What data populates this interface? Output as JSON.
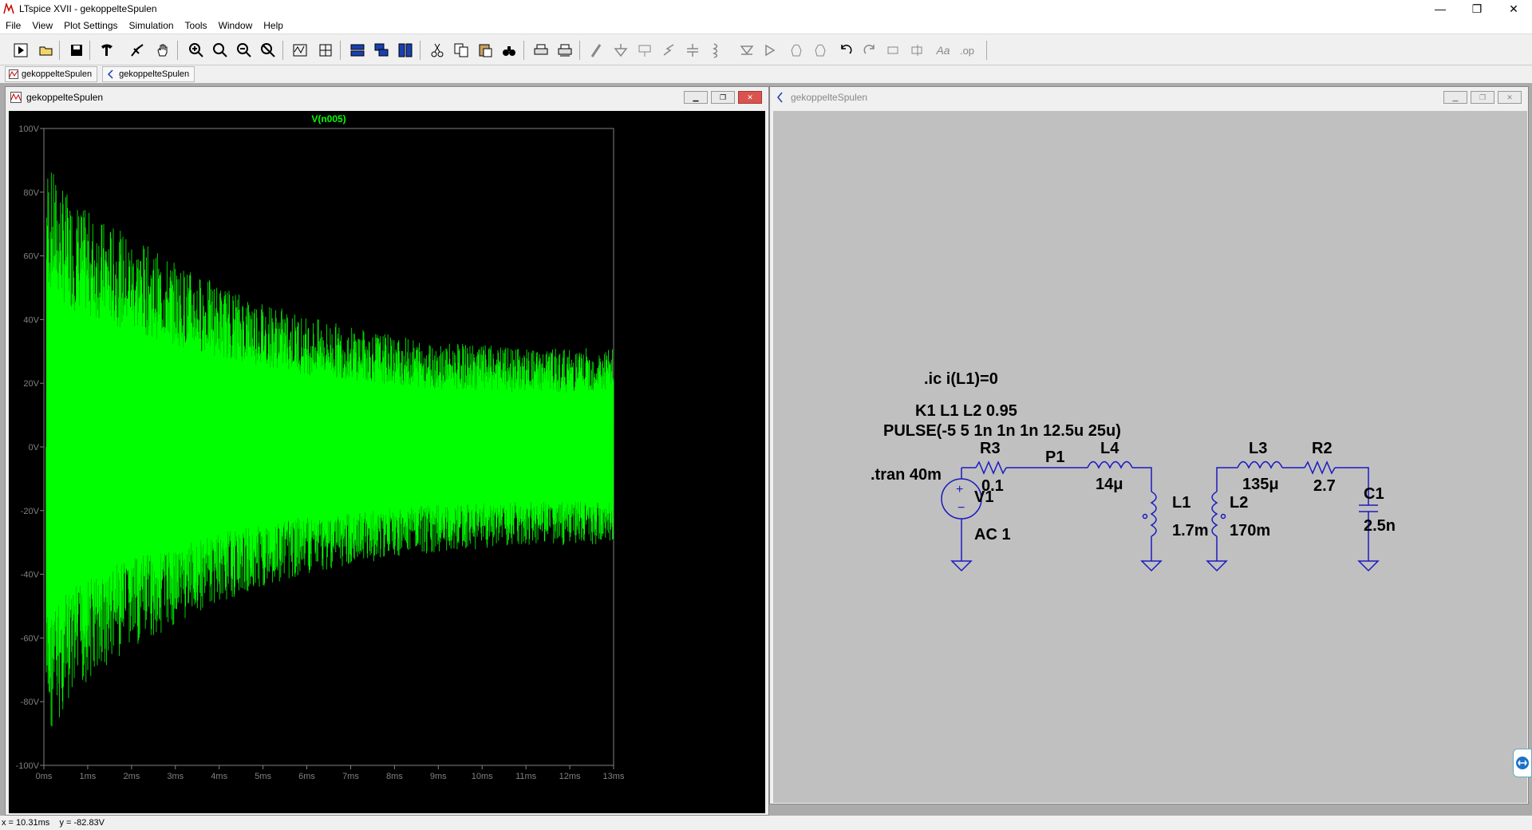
{
  "window": {
    "title": "LTspice XVII - gekoppelteSpulen",
    "controls": {
      "minimize": "—",
      "restore": "❐",
      "close": "✕"
    }
  },
  "menu": [
    "File",
    "View",
    "Plot Settings",
    "Simulation",
    "Tools",
    "Window",
    "Help"
  ],
  "toolbar": {
    "icons": [
      "run-icon",
      "open-icon",
      "save-icon",
      "control-panel-icon",
      "halt-icon",
      "pan-icon",
      "zoom-in-icon",
      "zoom-area-icon",
      "zoom-out-icon",
      "zoom-cancel-icon",
      "autorange-icon",
      "manual-limits-icon",
      "tile-horizontal-icon",
      "cascade-icon",
      "tile-vertical-icon",
      "cut-icon",
      "copy-icon",
      "paste-icon",
      "find-icon",
      "print-icon",
      "print-setup-icon",
      "wire-icon",
      "ground-icon",
      "label-icon",
      "resistor-icon",
      "capacitor-icon",
      "inductor-icon",
      "diode-icon",
      "component-icon",
      "move-icon",
      "drag-icon",
      "undo-icon",
      "redo-icon",
      "rotate-icon",
      "mirror-icon",
      "text-icon",
      "spice-directive-icon"
    ]
  },
  "doc_tabs": [
    {
      "label": "gekoppelteSpulen",
      "kind": "waveform"
    },
    {
      "label": "gekoppelteSpulen",
      "kind": "schematic"
    }
  ],
  "plot_window": {
    "title": "gekoppelteSpulen",
    "trace_label": "V(n005)",
    "colors": {
      "background": "#000000",
      "trace": "#00ff00",
      "axis": "#808080"
    }
  },
  "chart_data": {
    "type": "line",
    "title": "V(n005)",
    "xlabel": "",
    "ylabel": "",
    "x_ticks": [
      "0ms",
      "1ms",
      "2ms",
      "3ms",
      "4ms",
      "5ms",
      "6ms",
      "7ms",
      "8ms",
      "9ms",
      "10ms",
      "11ms",
      "12ms",
      "13ms"
    ],
    "y_ticks": [
      "100V",
      "80V",
      "60V",
      "40V",
      "20V",
      "0V",
      "-20V",
      "-40V",
      "-60V",
      "-80V",
      "-100V"
    ],
    "xlim": [
      0,
      13
    ],
    "ylim": [
      -100,
      100
    ],
    "series": [
      {
        "description": "Damped oscillation envelope",
        "envelope_upper": [
          [
            0.05,
            90
          ],
          [
            0.5,
            80
          ],
          [
            1,
            74
          ],
          [
            2,
            66
          ],
          [
            3,
            58
          ],
          [
            4,
            51
          ],
          [
            5,
            46
          ],
          [
            6,
            41
          ],
          [
            7,
            38
          ],
          [
            8,
            35
          ],
          [
            9,
            33
          ],
          [
            10,
            32
          ],
          [
            11,
            31
          ],
          [
            12,
            31
          ],
          [
            13,
            31
          ]
        ],
        "envelope_lower": [
          [
            0.05,
            -92
          ],
          [
            0.5,
            -84
          ],
          [
            1,
            -74
          ],
          [
            2,
            -64
          ],
          [
            3,
            -56
          ],
          [
            4,
            -49
          ],
          [
            5,
            -44
          ],
          [
            6,
            -40
          ],
          [
            7,
            -37
          ],
          [
            8,
            -35
          ],
          [
            9,
            -33
          ],
          [
            10,
            -32
          ],
          [
            11,
            -31
          ],
          [
            12,
            -31
          ],
          [
            13,
            -31
          ]
        ]
      }
    ]
  },
  "schematic_window": {
    "title": "gekoppelteSpulen",
    "directives": {
      "ic": ".ic i(L1)=0",
      "coupling": "K1 L1 L2 0.95",
      "pulse": "PULSE(-5 5 1n 1n 1n 12.5u 25u)",
      "tran": ".tran 40m"
    },
    "components": {
      "r3_name": "R3",
      "r3_value": "0.1",
      "p1_label": "P1",
      "l4_name": "L4",
      "l4_value": "14μ",
      "l1_name": "L1",
      "l1_value": "1.7m",
      "v1_name": "V1",
      "v1_value": "AC 1",
      "l3_name": "L3",
      "l3_value": "135μ",
      "r2_name": "R2",
      "r2_value": "2.7",
      "l2_name": "L2",
      "l2_value": "170m",
      "c1_name": "C1",
      "c1_value": "2.5n"
    },
    "colors": {
      "background": "#c0c0c0",
      "wire": "#1a1ac0",
      "text": "#000000"
    }
  },
  "status": "x = 10.31ms    y = -82.83V"
}
